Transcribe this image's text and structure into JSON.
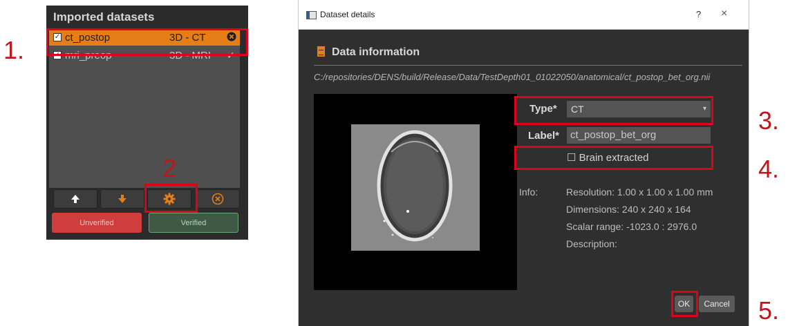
{
  "steps": [
    "1.",
    "2",
    "3.",
    "4.",
    "5."
  ],
  "left_panel": {
    "title": "Imported datasets",
    "datasets": [
      {
        "name": "ct_postop",
        "type": "3D - CT",
        "icon": "close-circle-icon",
        "selected": true
      },
      {
        "name": "mri_preop",
        "type": "3D - MRI",
        "icon": "check-icon",
        "selected": false
      }
    ],
    "buttons": [
      {
        "name": "move-up-button",
        "icon": "arrow-up-icon"
      },
      {
        "name": "move-down-button",
        "icon": "arrow-down-icon"
      },
      {
        "name": "settings-button",
        "icon": "gear-icon"
      },
      {
        "name": "remove-button",
        "icon": "close-circle-icon"
      }
    ],
    "unverified_label": "Unverified",
    "verified_label": "Verified"
  },
  "dialog": {
    "title": "Dataset details",
    "help": "?",
    "close": "×",
    "section_title": "Data information",
    "file_path": "C:/repositories/DENS/build/Release/Data/TestDepth01_01022050/anatomical/ct_postop_bet_org.nii",
    "type_label": "Type*",
    "type_value": "CT",
    "label_label": "Label*",
    "label_value": "ct_postop_bet_org",
    "brain_extracted_label": "Brain extracted",
    "brain_extracted_checked": false,
    "info_label": "Info:",
    "info_lines": [
      "Resolution: 1.00 x 1.00 x 1.00 mm",
      "Dimensions: 240 x 240 x 164",
      "Scalar range: -1023.0 : 2976.0",
      "Description:"
    ],
    "ok_label": "OK",
    "cancel_label": "Cancel"
  },
  "colors": {
    "accent": "#e67e17",
    "highlight_box": "#e1001a",
    "unverified": "#cf3d3d",
    "verified": "#3e5a45"
  }
}
